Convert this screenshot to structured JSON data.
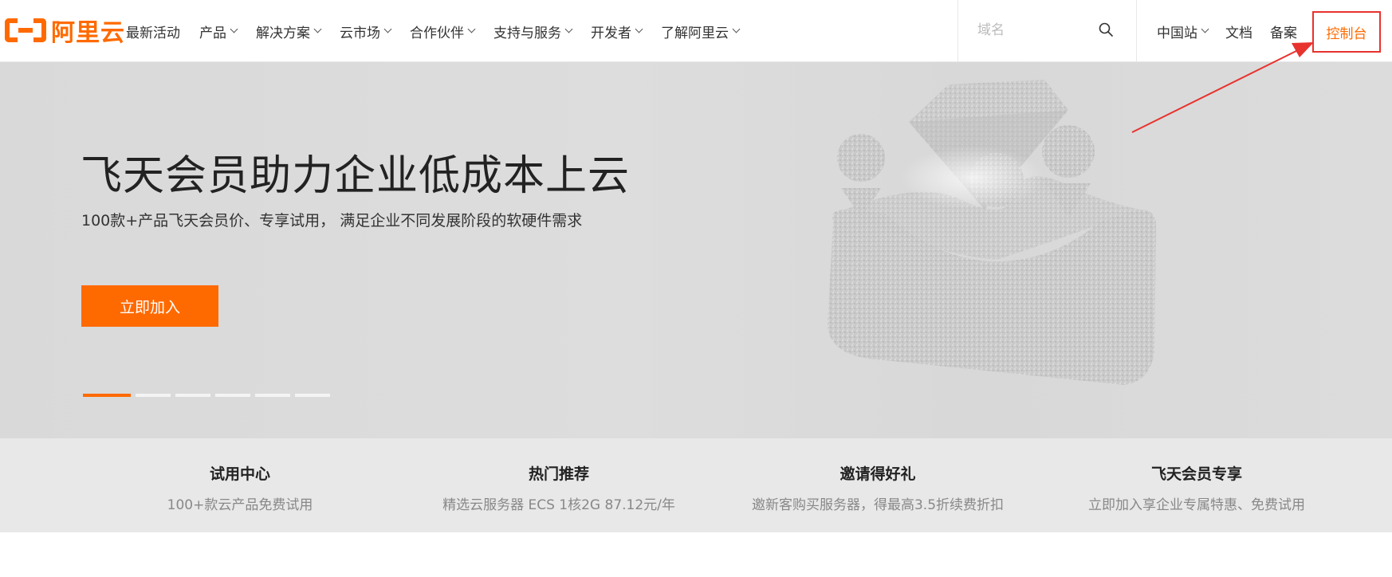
{
  "brand": {
    "name": "阿里云",
    "color": "#ff6a00"
  },
  "nav": {
    "items": [
      {
        "label": "最新活动",
        "has_dropdown": false
      },
      {
        "label": "产品",
        "has_dropdown": true
      },
      {
        "label": "解决方案",
        "has_dropdown": true
      },
      {
        "label": "云市场",
        "has_dropdown": true
      },
      {
        "label": "合作伙伴",
        "has_dropdown": true
      },
      {
        "label": "支持与服务",
        "has_dropdown": true
      },
      {
        "label": "开发者",
        "has_dropdown": true
      },
      {
        "label": "了解阿里云",
        "has_dropdown": true
      }
    ]
  },
  "search": {
    "placeholder": "域名",
    "icon": "search-icon"
  },
  "right_nav": {
    "site": "中国站",
    "docs": "文档",
    "filing": "备案",
    "console": "控制台"
  },
  "hero": {
    "title": "飞天会员助力企业低成本上云",
    "subtitle": "100款+产品飞天会员价、专享试用， 满足企业不同发展阶段的软硬件需求",
    "cta": "立即加入",
    "slide_count": 6,
    "active_slide": 1
  },
  "features": [
    {
      "title": "试用中心",
      "desc": "100+款云产品免费试用"
    },
    {
      "title": "热门推荐",
      "desc": "精选云服务器 ECS 1核2G 87.12元/年"
    },
    {
      "title": "邀请得好礼",
      "desc": "邀新客购买服务器，得最高3.5折续费折扣"
    },
    {
      "title": "飞天会员专享",
      "desc": "立即加入享企业专属特惠、免费试用"
    }
  ],
  "colors": {
    "accent": "#ff6a00",
    "annotation": "#e8322e"
  }
}
